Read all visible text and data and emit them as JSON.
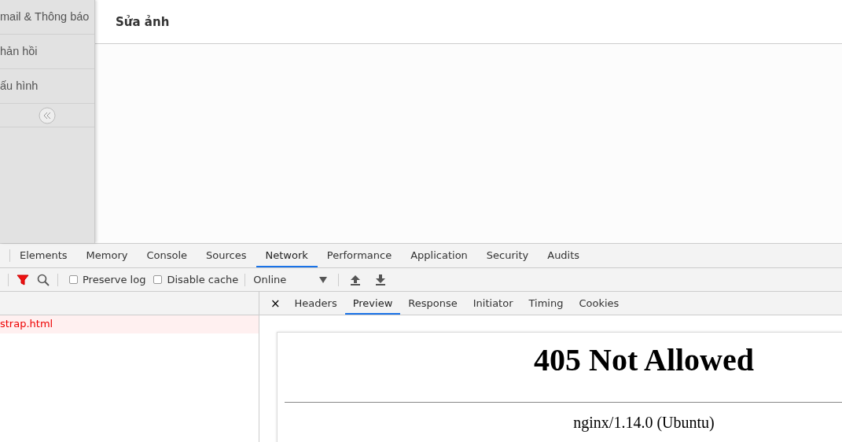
{
  "sidebar": {
    "items": [
      {
        "label": "mail & Thông báo"
      },
      {
        "label": "hản hồi"
      },
      {
        "label": "ấu hình"
      }
    ]
  },
  "page": {
    "title": "Sửa ảnh"
  },
  "devtools": {
    "tabs": [
      {
        "label": "Elements",
        "selected": false
      },
      {
        "label": "Memory",
        "selected": false
      },
      {
        "label": "Console",
        "selected": false
      },
      {
        "label": "Sources",
        "selected": false
      },
      {
        "label": "Network",
        "selected": true
      },
      {
        "label": "Performance",
        "selected": false
      },
      {
        "label": "Application",
        "selected": false
      },
      {
        "label": "Security",
        "selected": false
      },
      {
        "label": "Audits",
        "selected": false
      }
    ],
    "toolbar": {
      "checkboxes": [
        {
          "label": "Preserve log",
          "checked": false
        },
        {
          "label": "Disable cache",
          "checked": false
        }
      ],
      "throttle": "Online"
    },
    "requests": [
      {
        "name": "strap.html",
        "error": true
      }
    ],
    "close": "×",
    "detail_tabs": [
      {
        "label": "Headers",
        "selected": false
      },
      {
        "label": "Preview",
        "selected": true
      },
      {
        "label": "Response",
        "selected": false
      },
      {
        "label": "Initiator",
        "selected": false
      },
      {
        "label": "Timing",
        "selected": false
      },
      {
        "label": "Cookies",
        "selected": false
      }
    ],
    "preview": {
      "heading": "405 Not Allowed",
      "footer": "nginx/1.14.0 (Ubuntu)"
    }
  }
}
